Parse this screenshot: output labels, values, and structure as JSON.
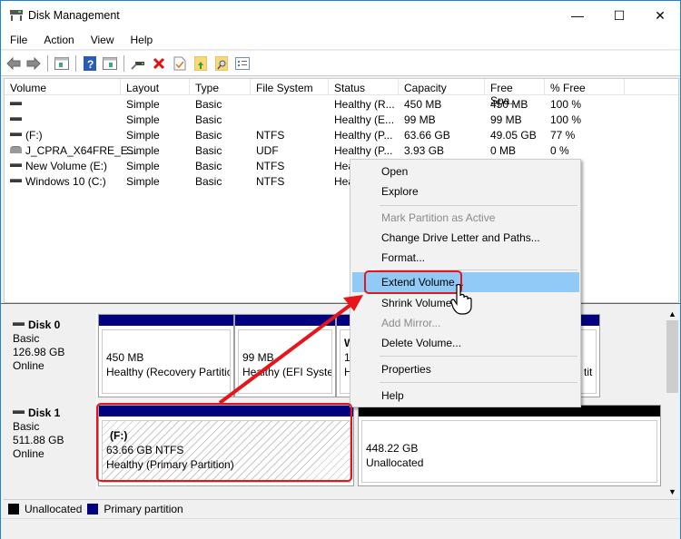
{
  "window": {
    "title": "Disk Management",
    "minimize": "—",
    "maximize": "☐",
    "close": "✕"
  },
  "menu": [
    "File",
    "Action",
    "View",
    "Help"
  ],
  "toolbar": {
    "icons": [
      "back-icon",
      "forward-icon",
      "console-tree-icon",
      "help-icon",
      "action-pane-icon",
      "connect-icon",
      "delete-icon",
      "check-icon",
      "folder-up-icon",
      "search-folder-icon",
      "properties-icon"
    ]
  },
  "volume_list": {
    "columns": [
      "Volume",
      "Layout",
      "Type",
      "File System",
      "Status",
      "Capacity",
      "Free Spa...",
      "% Free"
    ],
    "rows": [
      {
        "volume": "",
        "icon": "drive",
        "layout": "Simple",
        "type": "Basic",
        "fs": "",
        "status": "Healthy (R...",
        "capacity": "450 MB",
        "free": "450 MB",
        "pct": "100 %"
      },
      {
        "volume": "",
        "icon": "drive",
        "layout": "Simple",
        "type": "Basic",
        "fs": "",
        "status": "Healthy (E...",
        "capacity": "99 MB",
        "free": "99 MB",
        "pct": "100 %"
      },
      {
        "volume": "(F:)",
        "icon": "drive",
        "layout": "Simple",
        "type": "Basic",
        "fs": "NTFS",
        "status": "Healthy (P...",
        "capacity": "63.66 GB",
        "free": "49.05 GB",
        "pct": "77 %"
      },
      {
        "volume": "J_CPRA_X64FRE_E...",
        "icon": "cd",
        "layout": "Simple",
        "type": "Basic",
        "fs": "UDF",
        "status": "Healthy (P...",
        "capacity": "3.93 GB",
        "free": "0 MB",
        "pct": "0 %"
      },
      {
        "volume": "New Volume (E:)",
        "icon": "drive",
        "layout": "Simple",
        "type": "Basic",
        "fs": "NTFS",
        "status": "Hea",
        "capacity": "",
        "free": "",
        "pct": ""
      },
      {
        "volume": "Windows 10 (C:)",
        "icon": "drive",
        "layout": "Simple",
        "type": "Basic",
        "fs": "NTFS",
        "status": "Hea",
        "capacity": "",
        "free": "",
        "pct": ""
      }
    ]
  },
  "disks": [
    {
      "name": "Disk 0",
      "type": "Basic",
      "size": "126.98 GB",
      "state": "Online",
      "partitions": [
        {
          "line1": "",
          "line2": "450 MB",
          "line3": "Healthy (Recovery Partitic"
        },
        {
          "line1": "",
          "line2": "99 MB",
          "line3": "Healthy (EFI Syster"
        },
        {
          "line1": "W",
          "line2": "1",
          "line3": "H"
        },
        {
          "line1": "",
          "line2": "",
          "line3": "tit"
        }
      ]
    },
    {
      "name": "Disk 1",
      "type": "Basic",
      "size": "511.88 GB",
      "state": "Online",
      "partitions": [
        {
          "line1": "(F:)",
          "line2": "63.66 GB NTFS",
          "line3": "Healthy (Primary Partition)"
        },
        {
          "line1": "",
          "line2": "448.22 GB",
          "line3": "Unallocated"
        }
      ]
    }
  ],
  "legend": [
    {
      "label": "Unallocated",
      "color": "#000000"
    },
    {
      "label": "Primary partition",
      "color": "#000080"
    }
  ],
  "context_menu": {
    "items": [
      {
        "label": "Open",
        "disabled": false
      },
      {
        "label": "Explore",
        "disabled": false
      },
      {
        "label": "Mark Partition as Active",
        "disabled": true
      },
      {
        "label": "Change Drive Letter and Paths...",
        "disabled": false
      },
      {
        "label": "Format...",
        "disabled": false
      },
      {
        "label": "Extend Volume...",
        "disabled": false,
        "highlighted": true
      },
      {
        "label": "Shrink Volume...",
        "disabled": false
      },
      {
        "label": "Add Mirror...",
        "disabled": true
      },
      {
        "label": "Delete Volume...",
        "disabled": false
      },
      {
        "label": "Properties",
        "disabled": false
      },
      {
        "label": "Help",
        "disabled": false
      }
    ]
  },
  "colors": {
    "primary": "#000080",
    "unallocated": "#000000",
    "highlight": "#91c9f7",
    "annotation": "#e8141c"
  }
}
